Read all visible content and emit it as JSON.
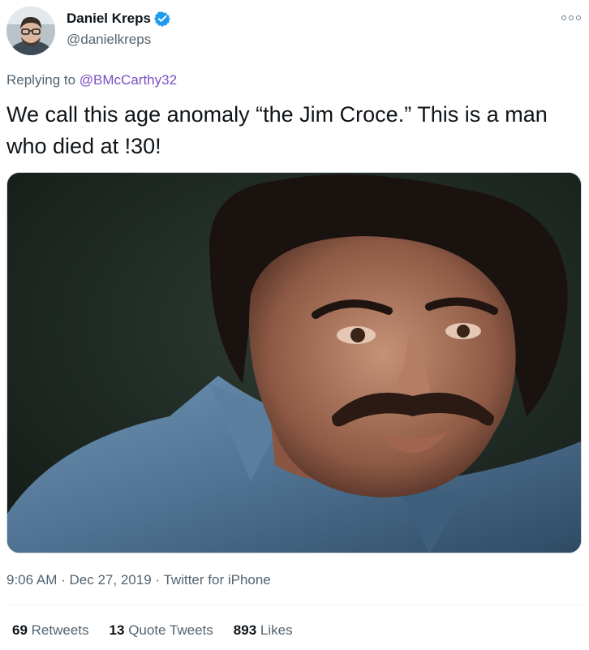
{
  "author": {
    "display_name": "Daniel Kreps",
    "handle": "@danielkreps",
    "verified": true,
    "avatar_icon": "user-avatar"
  },
  "reply": {
    "prefix": "Replying to",
    "mention": "@BMcCarthy32"
  },
  "tweet": {
    "text": "We call this age anomaly “the Jim Croce.” This is a man who died at !30!"
  },
  "media": {
    "kind": "photo",
    "description_icon": "portrait-photo"
  },
  "meta": {
    "time": "9:06 AM",
    "separator": "·",
    "date": "Dec 27, 2019",
    "source": "Twitter for iPhone"
  },
  "stats": {
    "retweets_count": "69",
    "retweets_label": "Retweets",
    "quotes_count": "13",
    "quotes_label": "Quote Tweets",
    "likes_count": "893",
    "likes_label": "Likes"
  },
  "colors": {
    "mention": "#7a4fbf",
    "verified": "#1d9bf0",
    "muted": "#536471"
  }
}
